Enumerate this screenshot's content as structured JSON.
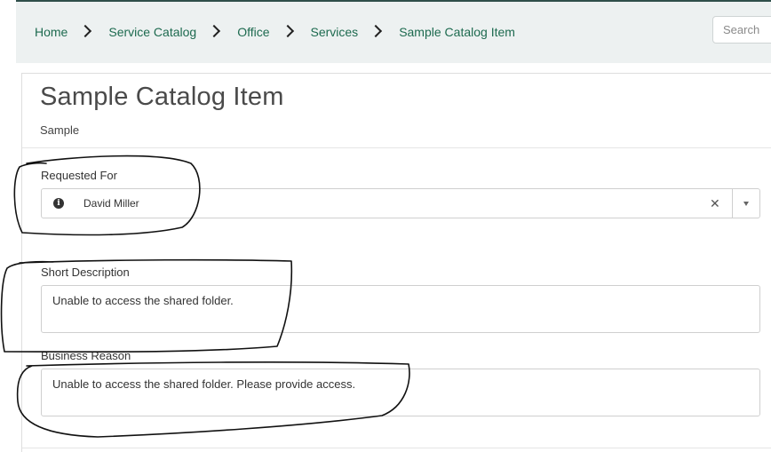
{
  "breadcrumb": {
    "items": [
      {
        "label": "Home"
      },
      {
        "label": "Service Catalog"
      },
      {
        "label": "Office"
      },
      {
        "label": "Services"
      },
      {
        "label": "Sample Catalog Item"
      }
    ]
  },
  "search": {
    "placeholder": "Search"
  },
  "item": {
    "title": "Sample Catalog Item",
    "subtitle": "Sample"
  },
  "form": {
    "requested_for": {
      "label": "Requested For",
      "value": "David Miller"
    },
    "short_description": {
      "label": "Short Description",
      "value": "Unable to access the shared folder."
    },
    "business_reason": {
      "label": "Business Reason",
      "value": "Unable to access the shared folder. Please provide access."
    }
  },
  "colors": {
    "header_bg": "#edf1f1",
    "link": "#1d6a4f",
    "annotation_stroke": "#111111"
  },
  "icons": {
    "breadcrumb_separator": "chevron-right-icon",
    "info": "info-circle-icon",
    "clear": "close-icon",
    "dropdown": "caret-down-icon"
  }
}
